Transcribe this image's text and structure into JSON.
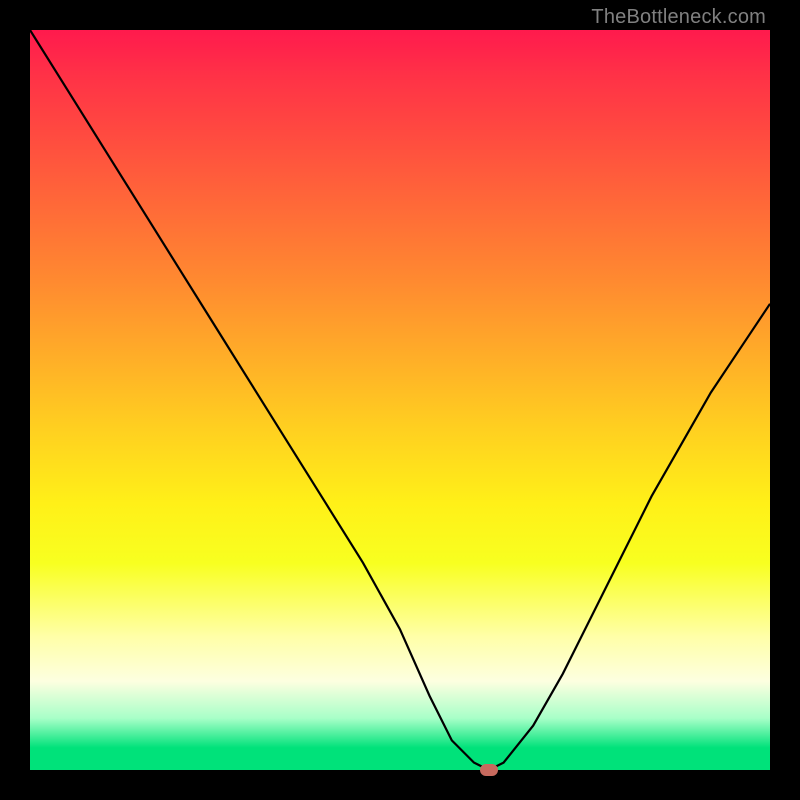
{
  "watermark_text": "TheBottleneck.com",
  "chart_data": {
    "type": "line",
    "title": "",
    "xlabel": "",
    "ylabel": "",
    "xlim": [
      0,
      100
    ],
    "ylim": [
      0,
      100
    ],
    "grid": false,
    "legend": false,
    "series": [
      {
        "name": "curve",
        "x": [
          0,
          5,
          10,
          15,
          20,
          25,
          30,
          35,
          40,
          45,
          50,
          54,
          57,
          60,
          62,
          64,
          68,
          72,
          76,
          80,
          84,
          88,
          92,
          96,
          100
        ],
        "values": [
          100,
          92,
          84,
          76,
          68,
          60,
          52,
          44,
          36,
          28,
          19,
          10,
          4,
          1,
          0,
          1,
          6,
          13,
          21,
          29,
          37,
          44,
          51,
          57,
          63
        ]
      }
    ],
    "marker": {
      "x": 62,
      "y": 0,
      "color": "#c76a5e"
    },
    "background_gradient_stops": [
      {
        "pos": 0,
        "color": "#ff1a4d"
      },
      {
        "pos": 50,
        "color": "#ffd020"
      },
      {
        "pos": 97,
        "color": "#00e27a"
      }
    ]
  }
}
